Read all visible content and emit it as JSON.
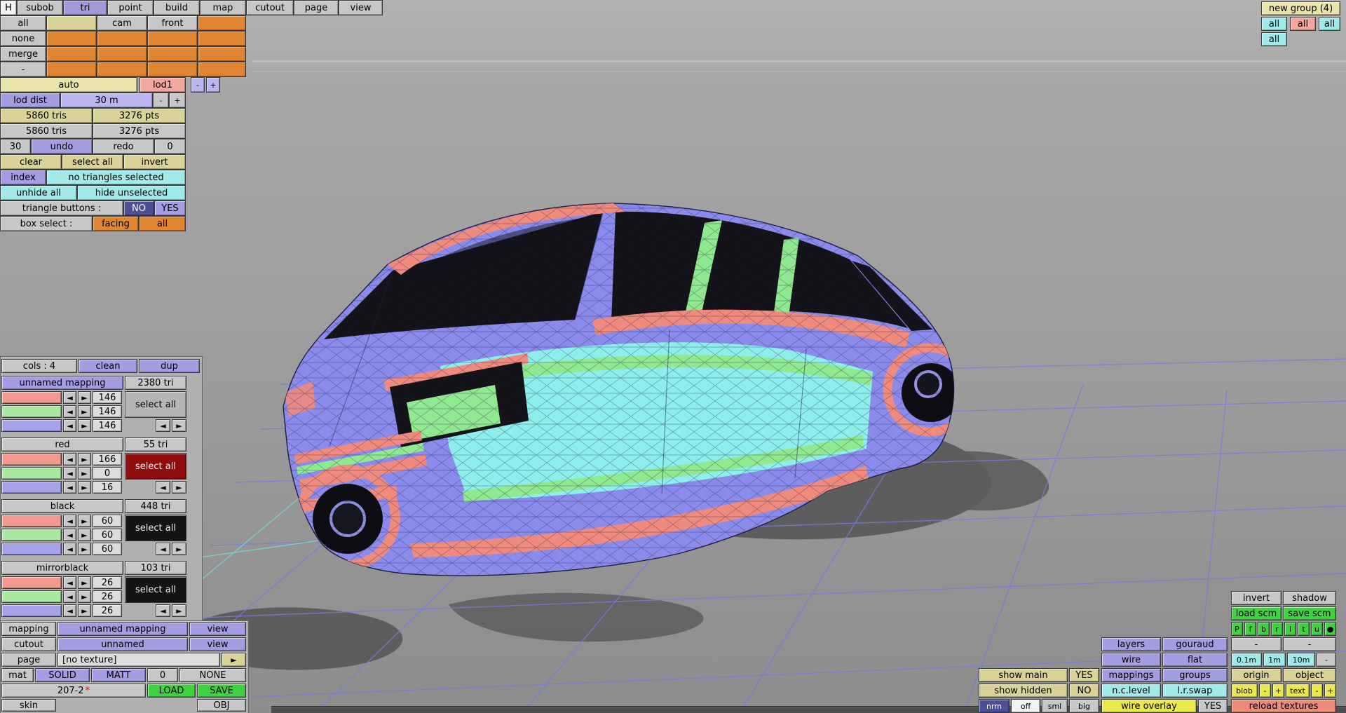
{
  "palette": {
    "viewport_gray": "#9a9a9a",
    "grid_purple": "#7a7ae0",
    "grid_cyan": "#72dcd8",
    "body_periwinkle": "#8b8bec",
    "trim_salmon": "#ef8a7e",
    "panel_cyan": "#8deeec",
    "accent_green": "#90e890",
    "ui_orange": "#e08632",
    "ui_purple": "#a49de2",
    "ui_cyan": "#a2eae8",
    "ui_tan": "#d9d398",
    "ui_green": "#3fd23f",
    "ui_yellow": "#e9e94e"
  },
  "icons": {
    "prev": "◄",
    "next": "►",
    "dot": "●",
    "expand": "►",
    "dirty": "*"
  },
  "menu": {
    "items": [
      "H",
      "subob",
      "tri",
      "point",
      "build",
      "map",
      "cutout",
      "page",
      "view"
    ]
  },
  "selection_grid": {
    "col1": [
      "all",
      "none",
      "merge",
      "-"
    ],
    "cam": "cam",
    "front": "front"
  },
  "lod": {
    "auto": "auto",
    "lod1": "lod1",
    "minus": "-",
    "plus": "+",
    "dist_label": "lod dist",
    "dist_value": "30 m",
    "dist_minus": "-",
    "dist_plus": "+",
    "stats_top": {
      "tris": "5860 tris",
      "pts": "3276 pts"
    },
    "stats_bottom": {
      "tris": "5860 tris",
      "pts": "3276 pts"
    },
    "undo_depth": "30",
    "undo": "undo",
    "redo": "redo",
    "redo_depth": "0"
  },
  "selection": {
    "clear": "clear",
    "select_all": "select all",
    "invert": "invert",
    "index": "index",
    "status": "no triangles selected",
    "unhide_all": "unhide all",
    "hide_unselected": "hide unselected",
    "triangle_buttons_label": "triangle buttons :",
    "no": "NO",
    "yes": "YES",
    "box_select_label": "box select :",
    "facing": "facing",
    "all": "all"
  },
  "cols_panel": {
    "cols_label": "cols : 4",
    "clean": "clean",
    "dup": "dup",
    "select_all": "select all",
    "groups": [
      {
        "name": "unnamed mapping",
        "tris": "2380 tri",
        "counts": [
          "146",
          "146",
          "146"
        ]
      },
      {
        "name": "red",
        "tris": "55 tri",
        "counts": [
          "166",
          "0",
          "16"
        ]
      },
      {
        "name": "black",
        "tris": "448 tri",
        "counts": [
          "60",
          "60",
          "60"
        ]
      },
      {
        "name": "mirrorblack",
        "tris": "103 tri",
        "counts": [
          "26",
          "26",
          "26"
        ]
      }
    ]
  },
  "mapping_panel": {
    "mapping_label": "mapping",
    "mapping_name": "unnamed mapping",
    "view": "view",
    "cutout_label": "cutout",
    "cutout_name": "unnamed",
    "page_label": "page",
    "page_value": "[no texture]",
    "mat_label": "mat",
    "solid": "SOLID",
    "matt": "MATT",
    "zero": "0",
    "none": "NONE",
    "model_name": "207-2",
    "load": "LOAD",
    "save": "SAVE",
    "skin": "skin",
    "obj": "OBJ"
  },
  "group_panel": {
    "new_group": "new group (4)",
    "all1": "all",
    "all2": "all",
    "all3": "all",
    "all4": "all"
  },
  "right_panel": {
    "invert": "invert",
    "shadow": "shadow",
    "load_scm": "load scm",
    "save_scm": "save scm",
    "axis": [
      "P",
      "f",
      "b",
      "r",
      "l",
      "t",
      "u",
      "●"
    ],
    "dash": "-",
    "layers": "layers",
    "gouraud": "gouraud",
    "wire": "wire",
    "flat": "flat",
    "d01": "0.1m",
    "d1": "1m",
    "d10": "10m",
    "show_main": "show main",
    "yes": "YES",
    "mappings": "mappings",
    "groups": "groups",
    "origin": "origin",
    "object": "object",
    "show_hidden": "show hidden",
    "no": "NO",
    "nclevel": "n.c.level",
    "lrswap": "l.r.swap",
    "blob": "blob",
    "minus": "-",
    "plus": "+",
    "text": "text",
    "nrm": "nrm",
    "off": "off",
    "sml": "sml",
    "big": "big",
    "wire_overlay": "wire overlay",
    "reload_textures": "reload textures"
  }
}
